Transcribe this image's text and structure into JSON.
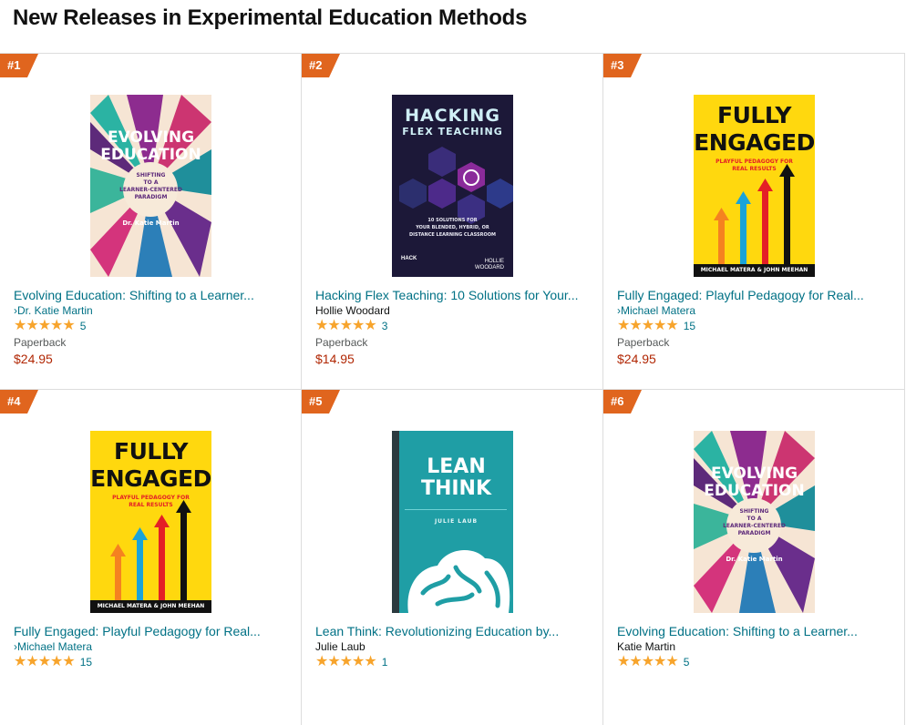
{
  "page": {
    "title": "New Releases in Experimental Education Methods"
  },
  "colors": {
    "link": "#007185",
    "price": "#b12704",
    "rank_badge": "#e0651e",
    "star": "#f7a42c"
  },
  "products": [
    {
      "rank": "#1",
      "title": "Evolving Education: Shifting to a Learner...",
      "author": "Dr. Katie Martin",
      "author_link": true,
      "rating_count": "5",
      "format": "Paperback",
      "price": "$24.95",
      "cover": {
        "title_lines": [
          "EVOLVING",
          "EDUCATION"
        ],
        "subtitle_lines": [
          "SHIFTING",
          "TO A",
          "LEARNER-CENTERED",
          "PARADIGM"
        ],
        "author": "Dr. Katie Martin"
      }
    },
    {
      "rank": "#2",
      "title": "Hacking Flex Teaching: 10 Solutions for Your...",
      "author": "Hollie Woodard",
      "author_link": false,
      "rating_count": "3",
      "format": "Paperback",
      "price": "$14.95",
      "cover": {
        "title_lines": [
          "HACKING",
          "FLEX TEACHING"
        ],
        "subtitle_lines": [
          "10 SOLUTIONS FOR",
          "YOUR BLENDED, HYBRID, OR",
          "DISTANCE LEARNING CLASSROOM"
        ],
        "publisher": "HACK",
        "author_lines": [
          "HOLLIE",
          "WOODARD"
        ]
      }
    },
    {
      "rank": "#3",
      "title": "Fully Engaged: Playful Pedagogy for Real...",
      "author": "Michael Matera",
      "author_link": true,
      "rating_count": "15",
      "format": "Paperback",
      "price": "$24.95",
      "cover": {
        "title_lines": [
          "FULLY",
          "ENGAGED"
        ],
        "subtitle": "PLAYFUL PEDAGOGY FOR REAL RESULTS",
        "author": "MICHAEL MATERA & JOHN MEEHAN"
      }
    },
    {
      "rank": "#4",
      "title": "Fully Engaged: Playful Pedagogy for Real...",
      "author": "Michael Matera",
      "author_link": true,
      "rating_count": "15",
      "cover": {
        "title_lines": [
          "FULLY",
          "ENGAGED"
        ],
        "subtitle": "PLAYFUL PEDAGOGY FOR REAL RESULTS",
        "author": "MICHAEL MATERA & JOHN MEEHAN"
      }
    },
    {
      "rank": "#5",
      "title": "Lean Think: Revolutionizing Education by...",
      "author": "Julie Laub",
      "author_link": false,
      "rating_count": "1",
      "cover": {
        "title_lines": [
          "LEAN",
          "THINK"
        ],
        "author": "JULIE LAUB"
      }
    },
    {
      "rank": "#6",
      "title": "Evolving Education: Shifting to a Learner...",
      "author": "Katie Martin",
      "author_link": false,
      "rating_count": "5",
      "cover": {
        "title_lines": [
          "EVOLVING",
          "EDUCATION"
        ],
        "subtitle_lines": [
          "SHIFTING",
          "TO A",
          "LEARNER-CENTERED",
          "PARADIGM"
        ],
        "author": "Dr. Katie Martin"
      }
    }
  ],
  "icons": {
    "star": "star-icon",
    "author_arrow": "chevron-right-icon"
  }
}
